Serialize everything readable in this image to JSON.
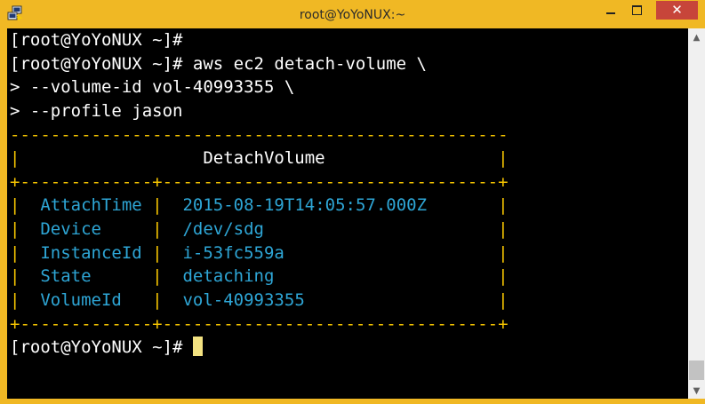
{
  "window": {
    "title": "root@YoYoNUX:~",
    "close_glyph": "✕",
    "colors": {
      "frame": "#f0b824",
      "close_button": "#c7453a",
      "terminal_bg": "#000000",
      "prompt_fg": "#ffffff",
      "output_fg": "#f5c400",
      "values_fg": "#2ea6d6",
      "cursor": "#f3e281"
    }
  },
  "terminal": {
    "lines": [
      {
        "segments": [
          {
            "text": "[root@YoYoNUX ~]#",
            "color": "white"
          }
        ]
      },
      {
        "segments": [
          {
            "text": "[root@YoYoNUX ~]# aws ec2 detach-volume \\",
            "color": "white"
          }
        ]
      },
      {
        "segments": [
          {
            "text": "> --volume-id vol-40993355 \\",
            "color": "white"
          }
        ]
      },
      {
        "segments": [
          {
            "text": "> --profile jason",
            "color": "white"
          }
        ]
      },
      {
        "segments": [
          {
            "text": "-------------------------------------------------",
            "color": "yellow"
          }
        ]
      },
      {
        "segments": [
          {
            "text": "|",
            "color": "yellow"
          },
          {
            "text": "                  DetachVolume                 ",
            "color": "white"
          },
          {
            "text": "|",
            "color": "yellow"
          }
        ]
      },
      {
        "segments": [
          {
            "text": "+-------------+---------------------------------+",
            "color": "yellow"
          }
        ]
      },
      {
        "segments": [
          {
            "text": "|  ",
            "color": "yellow"
          },
          {
            "text": "AttachTime",
            "color": "cyan"
          },
          {
            "text": " |  ",
            "color": "yellow"
          },
          {
            "text": "2015-08-19T14:05:57.000Z",
            "color": "cyan"
          },
          {
            "text": "       |",
            "color": "yellow"
          }
        ]
      },
      {
        "segments": [
          {
            "text": "|  ",
            "color": "yellow"
          },
          {
            "text": "Device    ",
            "color": "cyan"
          },
          {
            "text": " |  ",
            "color": "yellow"
          },
          {
            "text": "/dev/sdg                ",
            "color": "cyan"
          },
          {
            "text": "       |",
            "color": "yellow"
          }
        ]
      },
      {
        "segments": [
          {
            "text": "|  ",
            "color": "yellow"
          },
          {
            "text": "InstanceId",
            "color": "cyan"
          },
          {
            "text": " |  ",
            "color": "yellow"
          },
          {
            "text": "i-53fc559a              ",
            "color": "cyan"
          },
          {
            "text": "       |",
            "color": "yellow"
          }
        ]
      },
      {
        "segments": [
          {
            "text": "|  ",
            "color": "yellow"
          },
          {
            "text": "State     ",
            "color": "cyan"
          },
          {
            "text": " |  ",
            "color": "yellow"
          },
          {
            "text": "detaching               ",
            "color": "cyan"
          },
          {
            "text": "       |",
            "color": "yellow"
          }
        ]
      },
      {
        "segments": [
          {
            "text": "|  ",
            "color": "yellow"
          },
          {
            "text": "VolumeId  ",
            "color": "cyan"
          },
          {
            "text": " |  ",
            "color": "yellow"
          },
          {
            "text": "vol-40993355            ",
            "color": "cyan"
          },
          {
            "text": "       |",
            "color": "yellow"
          }
        ]
      },
      {
        "segments": [
          {
            "text": "+-------------+---------------------------------+",
            "color": "yellow"
          }
        ]
      },
      {
        "segments": [
          {
            "text": "[root@YoYoNUX ~]# ",
            "color": "white"
          }
        ],
        "cursor": true
      }
    ]
  }
}
